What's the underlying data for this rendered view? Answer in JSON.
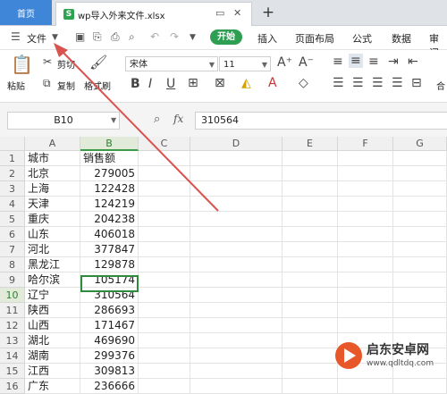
{
  "tabs": {
    "home": "首页",
    "file_name": "wp导入外来文件.xlsx",
    "file_icon": "S"
  },
  "menu": {
    "file": "文件",
    "start": "开始",
    "items": [
      "插入",
      "页面布局",
      "公式",
      "数据",
      "审阅"
    ]
  },
  "ribbon": {
    "cut": "剪切",
    "paste": "粘贴",
    "copy": "复制",
    "format_painter": "格式刷",
    "font_name": "宋体",
    "font_size": "11",
    "merge": "合"
  },
  "formula_bar": {
    "cell_ref": "B10",
    "fx": "fx",
    "value": "310564"
  },
  "columns": [
    "A",
    "B",
    "C",
    "D",
    "E",
    "F",
    "G"
  ],
  "rows": [
    {
      "n": "1",
      "a": "城市",
      "b": "销售额"
    },
    {
      "n": "2",
      "a": "北京",
      "b": "279005"
    },
    {
      "n": "3",
      "a": "上海",
      "b": "122428"
    },
    {
      "n": "4",
      "a": "天津",
      "b": "124219"
    },
    {
      "n": "5",
      "a": "重庆",
      "b": "204238"
    },
    {
      "n": "6",
      "a": "山东",
      "b": "406018"
    },
    {
      "n": "7",
      "a": "河北",
      "b": "377847"
    },
    {
      "n": "8",
      "a": "黑龙江",
      "b": "129878"
    },
    {
      "n": "9",
      "a": "哈尔滨",
      "b": "105174"
    },
    {
      "n": "10",
      "a": "辽宁",
      "b": "310564"
    },
    {
      "n": "11",
      "a": "陕西",
      "b": "286693"
    },
    {
      "n": "12",
      "a": "山西",
      "b": "171467"
    },
    {
      "n": "13",
      "a": "湖北",
      "b": "469690"
    },
    {
      "n": "14",
      "a": "湖南",
      "b": "299376"
    },
    {
      "n": "15",
      "a": "江西",
      "b": "309813"
    },
    {
      "n": "16",
      "a": "广东",
      "b": "236666"
    }
  ],
  "selected_row": "10",
  "watermark": {
    "title": "启东安卓网",
    "url": "www.qdltdq.com"
  },
  "colors": {
    "accent_green": "#2e9e52",
    "home_blue": "#3f86d9",
    "arrow_red": "#d9534f"
  }
}
